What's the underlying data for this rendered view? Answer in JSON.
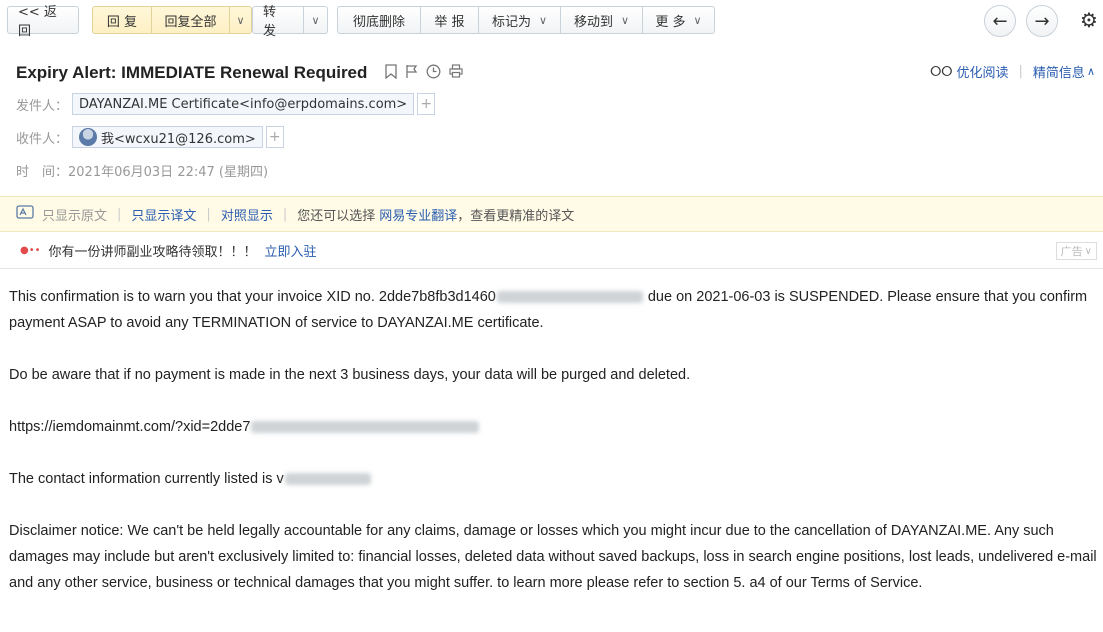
{
  "toolbar": {
    "back": "<< 返回",
    "reply": "回 复",
    "reply_all": "回复全部",
    "forward": "转 发",
    "delete_perm": "彻底删除",
    "report": "举 报",
    "mark_as": "标记为",
    "move_to": "移动到",
    "more": "更 多"
  },
  "header": {
    "subject": "Expiry Alert: IMMEDIATE Renewal Required",
    "read_mode": "优化阅读",
    "brief_info": "精简信息",
    "from_label": "发件人：",
    "from_value": "DAYANZAI.ME Certificate<info@erpdomains.com>",
    "to_label": "收件人：",
    "to_value": "我<wcxu21@126.com>",
    "time_label": "时　间：",
    "time_value": "2021年06月03日 22:47 (星期四)"
  },
  "translate_bar": {
    "original_only": "只显示原文",
    "translation_only": "只显示译文",
    "compare": "对照显示",
    "hint_prefix": "您还可以选择",
    "pro_translate": "网易专业翻译",
    "hint_suffix": "，查看更精准的译文"
  },
  "ad": {
    "text": "你有一份讲师副业攻略待领取！！！",
    "link": "立即入驻",
    "tag": "广告"
  },
  "body": {
    "p1_a": "This confirmation is to warn you that your invoice XID no. 2dde7b8fb3d1460",
    "p1_b": " due on 2021-06-03 is SUSPENDED. Please ensure that you confirm payment ASAP to avoid any TERMINATION of service to DAYANZAI.ME certificate.",
    "p2": "Do be aware that if no payment is made in the next 3 business days, your data will be purged and deleted.",
    "p3": "https://iemdomainmt.com/?xid=2dde7",
    "p4": "The contact information currently listed is v",
    "p5": "Disclaimer notice: We can't be held legally accountable for any claims, damage or losses which you might incur due to the cancellation of DAYANZAI.ME. Any such damages may include but aren't exclusively limited to: financial losses, deleted data without saved backups, loss in search engine positions, lost leads, undelivered e-mail and any other service, business or technical damages that you might suffer. to learn more please refer to section 5. a4 of our Terms of Service."
  }
}
